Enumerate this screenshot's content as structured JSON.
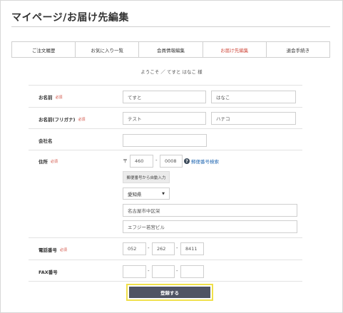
{
  "header": {
    "title": "マイページ/お届け先編集"
  },
  "tabs": [
    {
      "label": "ご注文履歴"
    },
    {
      "label": "お気に入り一覧"
    },
    {
      "label": "会員情報編集"
    },
    {
      "label": "お届け先編集"
    },
    {
      "label": "退会手続き"
    }
  ],
  "welcome": "ようこそ ／ てすと はなこ 様",
  "required_mark": "必須",
  "form": {
    "name": {
      "label": "お名前",
      "last": "てすと",
      "first": "はなこ"
    },
    "kana": {
      "label": "お名前(フリガナ)",
      "last": "テスト",
      "first": "ハナコ"
    },
    "company": {
      "label": "会社名",
      "value": ""
    },
    "address": {
      "label": "住所",
      "zip_mark": "〒",
      "zip1": "460",
      "zip2": "0008",
      "zip_link": "郵便番号検索",
      "auto_button": "郵便番号から自動入力",
      "prefecture": "愛知県",
      "city": "名古屋市中区栄",
      "building": "エフジー若宮ビル"
    },
    "phone": {
      "label": "電話番号",
      "p1": "052",
      "p2": "262",
      "p3": "8411"
    },
    "fax": {
      "label": "FAX番号",
      "p1": "",
      "p2": "",
      "p3": ""
    }
  },
  "submit": {
    "label": "登録する"
  },
  "colors": {
    "accent": "#d04b3e",
    "link": "#2a6db5",
    "button": "#505463",
    "focus": "#f0e04a"
  }
}
